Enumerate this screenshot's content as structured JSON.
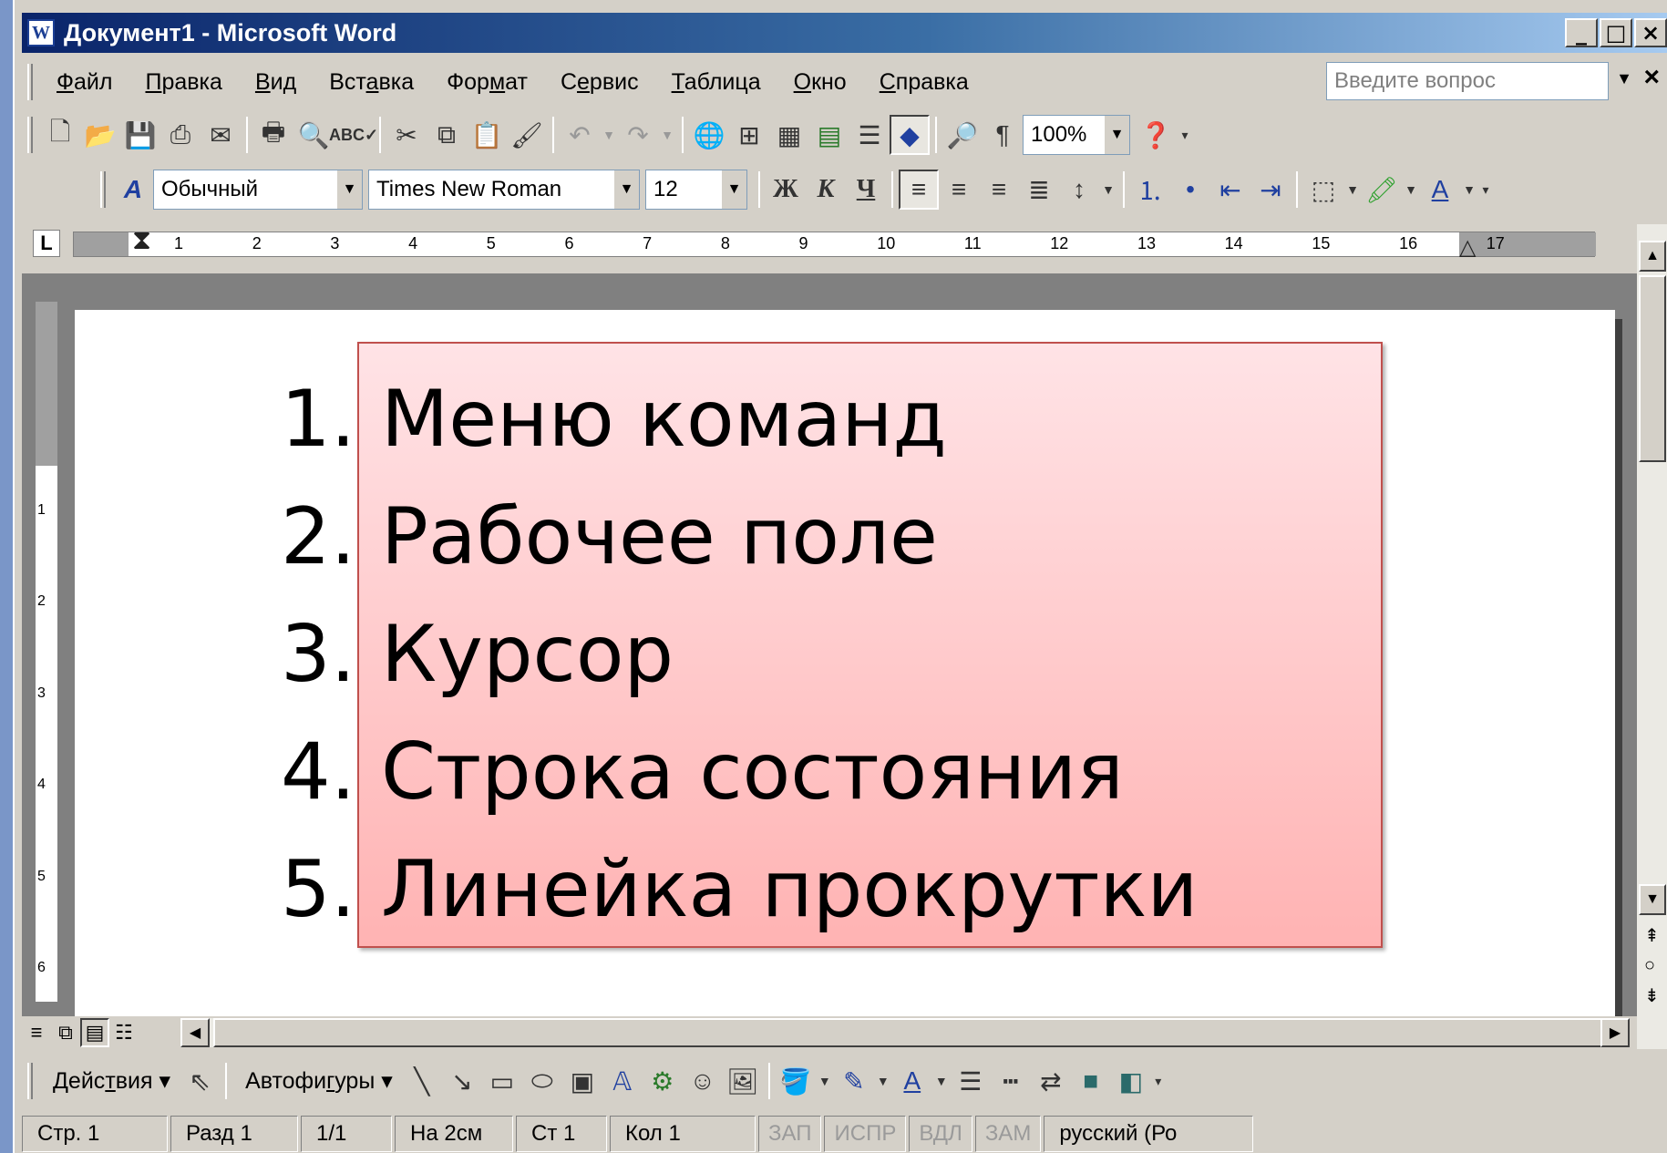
{
  "window": {
    "title": "Документ1 - Microsoft Word",
    "minimize_glyph": "_",
    "maximize_glyph": "□",
    "close_glyph": "×"
  },
  "menu": {
    "items": [
      {
        "pre": "",
        "u": "Ф",
        "post": "айл"
      },
      {
        "pre": "",
        "u": "П",
        "post": "равка"
      },
      {
        "pre": "",
        "u": "В",
        "post": "ид"
      },
      {
        "pre": "Вст",
        "u": "а",
        "post": "вка"
      },
      {
        "pre": "Фор",
        "u": "м",
        "post": "ат"
      },
      {
        "pre": "С",
        "u": "е",
        "post": "рвис"
      },
      {
        "pre": "",
        "u": "Т",
        "post": "аблица"
      },
      {
        "pre": "",
        "u": "О",
        "post": "кно"
      },
      {
        "pre": "",
        "u": "С",
        "post": "правка"
      }
    ],
    "ask_placeholder": "Введите вопрос",
    "doc_close": "×"
  },
  "standard_toolbar": {
    "zoom": "100%",
    "pilcrow": "¶"
  },
  "format_toolbar": {
    "style": "Обычный",
    "font": "Times New Roman",
    "size": "12",
    "bold": "Ж",
    "italic": "К",
    "underline": "Ч"
  },
  "ruler": {
    "corner": "L",
    "numbers": [
      "1",
      "2",
      "3",
      "4",
      "5",
      "6",
      "7",
      "8",
      "9",
      "10",
      "11",
      "12",
      "13",
      "14",
      "15",
      "16",
      "17"
    ],
    "vertical_numbers": [
      "1",
      "2",
      "3",
      "4",
      "5",
      "6"
    ]
  },
  "document": {
    "list": [
      {
        "num": "1.",
        "text": "Меню команд"
      },
      {
        "num": "2.",
        "text": "Рабочее поле"
      },
      {
        "num": "3.",
        "text": "Курсор"
      },
      {
        "num": "4.",
        "text": "Строка состояния"
      },
      {
        "num": "5.",
        "text": "Линейка прокрутки"
      }
    ],
    "box_colors": {
      "top": "#ffe3e6",
      "bottom": "#ffb3b3",
      "border": "#c0504d"
    }
  },
  "drawing_toolbar": {
    "actions_pre": "Дейс",
    "actions_u": "т",
    "actions_post": "вия",
    "autoshapes_pre": "Автофи",
    "autoshapes_u": "г",
    "autoshapes_post": "уры"
  },
  "statusbar": {
    "page": "Стр. 1",
    "section": "Разд 1",
    "pages": "1/1",
    "at": "На 2см",
    "line": "Ст 1",
    "col": "Кол 1",
    "rec": "ЗАП",
    "trk": "ИСПР",
    "ext": "ВДЛ",
    "ovr": "ЗАМ",
    "language": "русский (Ро"
  }
}
